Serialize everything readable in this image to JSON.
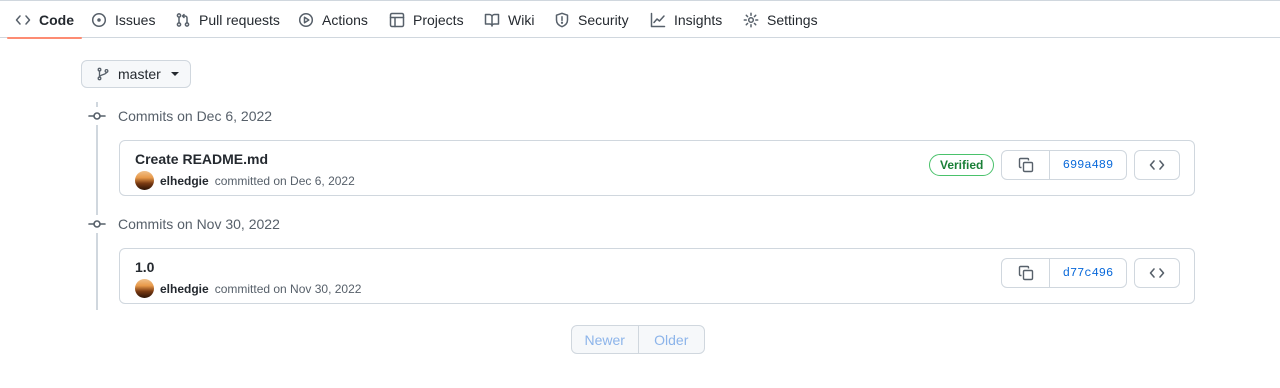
{
  "nav": {
    "tabs": [
      {
        "label": "Code",
        "icon": "code-icon",
        "active": true
      },
      {
        "label": "Issues",
        "icon": "issue-opened-icon"
      },
      {
        "label": "Pull requests",
        "icon": "git-pull-request-icon"
      },
      {
        "label": "Actions",
        "icon": "play-icon"
      },
      {
        "label": "Projects",
        "icon": "table-icon"
      },
      {
        "label": "Wiki",
        "icon": "book-icon"
      },
      {
        "label": "Security",
        "icon": "shield-icon"
      },
      {
        "label": "Insights",
        "icon": "graph-icon"
      },
      {
        "label": "Settings",
        "icon": "gear-icon"
      }
    ]
  },
  "branch": {
    "name": "master"
  },
  "groups": [
    {
      "heading": "Commits on Dec 6, 2022",
      "commits": [
        {
          "title": "Create README.md",
          "author": "elhedgie",
          "action": "committed on Dec 6, 2022",
          "verified": "Verified",
          "sha": "699a489"
        }
      ]
    },
    {
      "heading": "Commits on Nov 30, 2022",
      "commits": [
        {
          "title": "1.0",
          "author": "elhedgie",
          "action": "committed on Nov 30, 2022",
          "sha": "d77c496"
        }
      ]
    }
  ],
  "pagination": {
    "newer": "Newer",
    "older": "Older"
  },
  "colors": {
    "accent_underline": "#fd8c73",
    "link": "#0969da",
    "verified": "#1a7f37"
  }
}
